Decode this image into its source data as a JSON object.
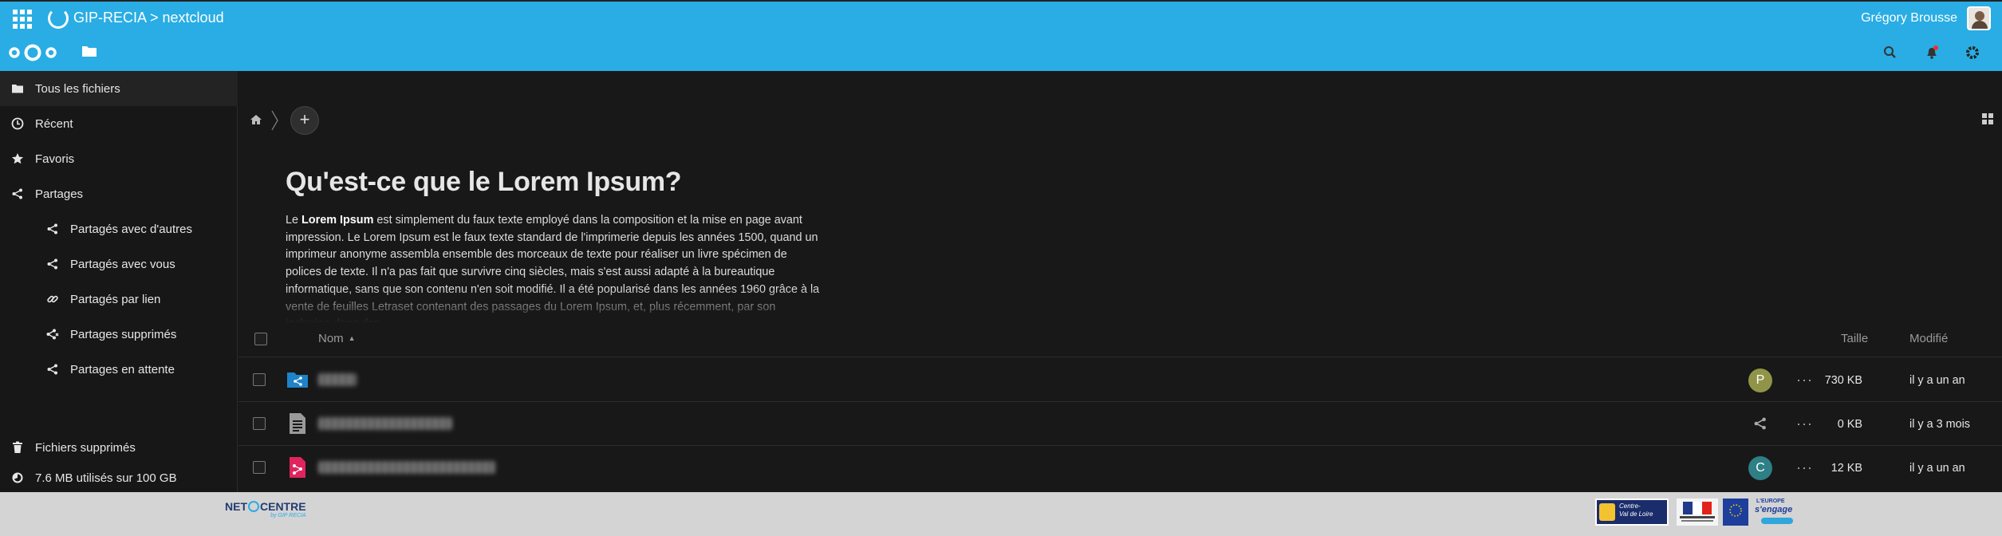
{
  "topbar": {
    "title": "GIP-RECIA > nextcloud",
    "user_name": "Grégory Brousse"
  },
  "header": {
    "icons": [
      "app-grid-icon",
      "nextcloud-logo",
      "files-icon",
      "search-icon",
      "notifications-icon",
      "settings-icon"
    ]
  },
  "sidebar": {
    "items": [
      {
        "label": "Tous les fichiers",
        "icon": "folder-icon"
      },
      {
        "label": "Récent",
        "icon": "clock-icon"
      },
      {
        "label": "Favoris",
        "icon": "star-icon"
      },
      {
        "label": "Partages",
        "icon": "share-icon"
      },
      {
        "label": "Partagés avec d'autres",
        "icon": "share-icon"
      },
      {
        "label": "Partagés avec vous",
        "icon": "share-icon"
      },
      {
        "label": "Partagés par lien",
        "icon": "link-icon"
      },
      {
        "label": "Partages supprimés",
        "icon": "share-deleted-icon"
      },
      {
        "label": "Partages en attente",
        "icon": "share-icon"
      }
    ],
    "trash_label": "Fichiers supprimés",
    "quota_label": "7.6 MB utilisés sur 100 GB"
  },
  "readme": {
    "title": "Qu'est-ce que le Lorem Ipsum?",
    "intro_prefix": "Le ",
    "intro_bold": "Lorem Ipsum",
    "body": " est simplement du faux texte employé dans la composition et la mise en page avant impression. Le Lorem Ipsum est le faux texte standard de l'imprimerie depuis les années 1500, quand un imprimeur anonyme assembla ensemble des morceaux de texte pour réaliser un livre spécimen de polices de texte. Il n'a pas fait que survivre cinq siècles, mais s'est aussi adapté à la bureautique informatique, sans que son contenu n'en soit modifié. Il a été popularisé dans les années 1960 grâce à la vente de feuilles Letraset contenant des passages du Lorem Ipsum, et, plus récemment, par son inclusion dans des"
  },
  "table": {
    "col_name": "Nom",
    "col_size": "Taille",
    "col_modified": "Modifié",
    "rows": [
      {
        "type": "shared-folder",
        "avatar": "P",
        "avatar_color": "#8f9448",
        "size": "730 KB",
        "modified": "il y a un an",
        "name_chars": 5
      },
      {
        "type": "text-file",
        "avatar": "",
        "size": "0 KB",
        "modified": "il y a 3 mois",
        "name_chars": 17
      },
      {
        "type": "diagram-file",
        "avatar": "C",
        "avatar_color": "#2e7f86",
        "size": "12 KB",
        "modified": "il y a un an",
        "name_chars": 23
      }
    ]
  },
  "footer": {
    "brand": "NETOCENTRE",
    "brand_sub": "by GIP RECIA",
    "partner_logos": [
      "Centre-Val de Loire",
      "République Française",
      "Union Européenne",
      "L'Europe s'engage"
    ]
  },
  "colors": {
    "accent": "#29ade4",
    "background": "#181818",
    "sidebar": "#171717",
    "footer": "#d4d4d4"
  }
}
